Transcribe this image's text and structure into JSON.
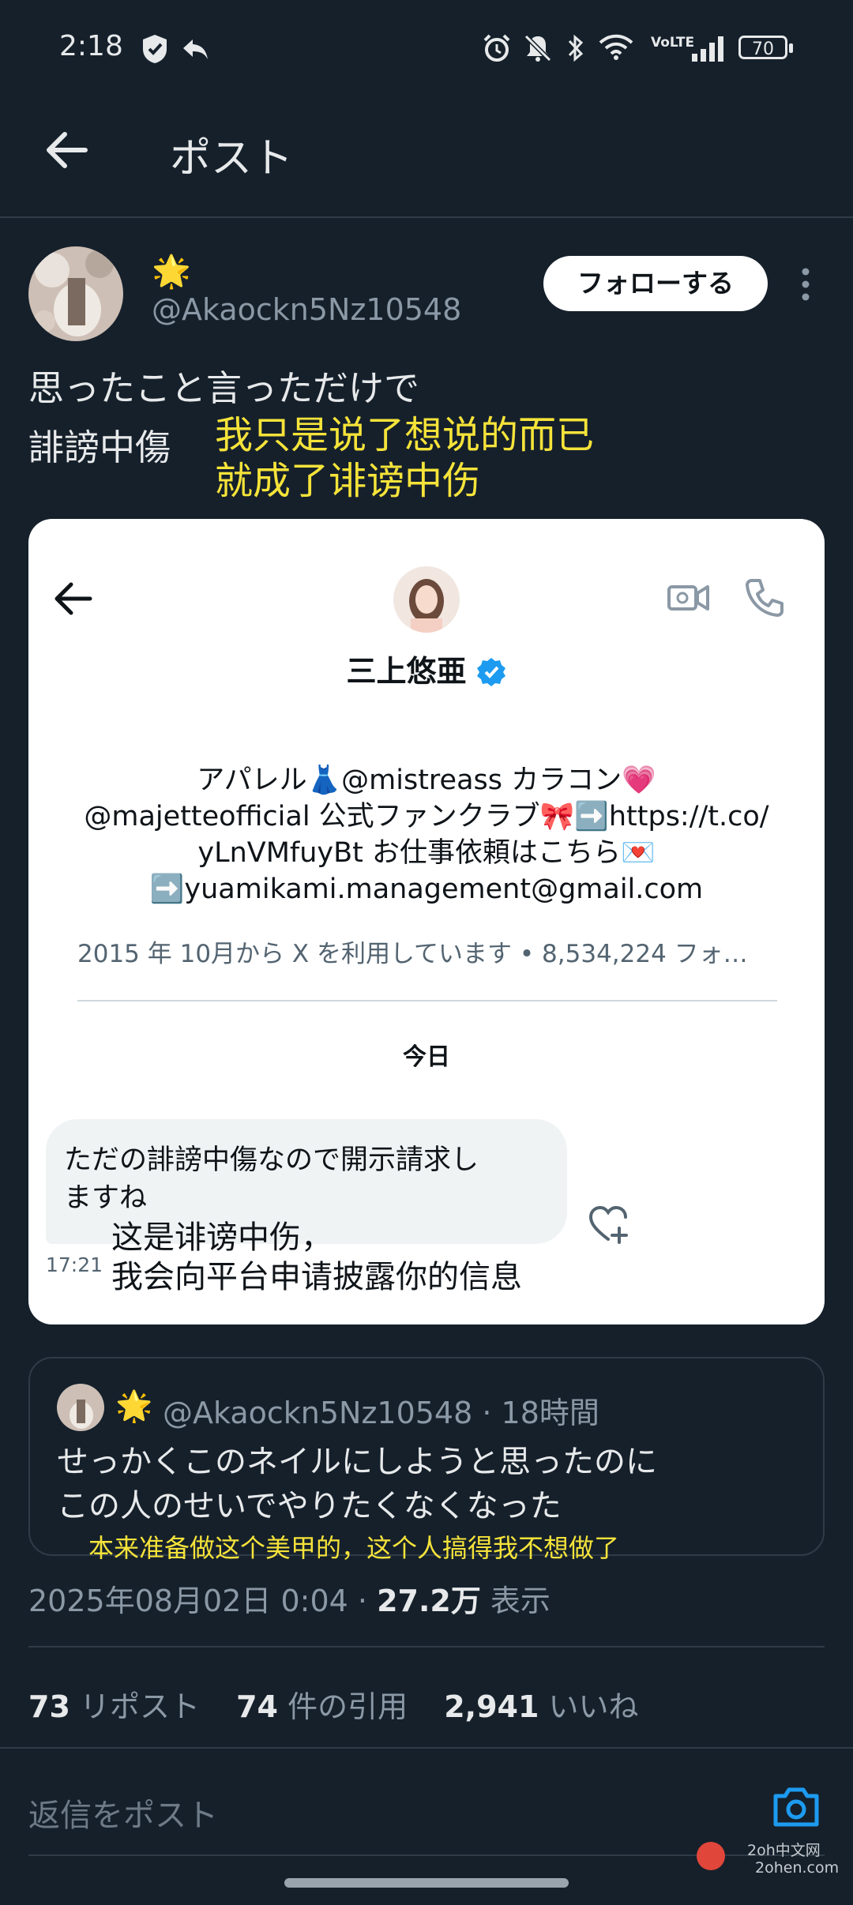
{
  "status_bar": {
    "time": "2:18",
    "battery": "70",
    "network": "VoLTE"
  },
  "header": {
    "title": "ポスト"
  },
  "post": {
    "handle": "@Akaockn5Nz10548",
    "badge_emoji": "🌟",
    "follow_label": "フォローする",
    "text_line1": "思ったこと言っただけで",
    "text_line2": "誹謗中傷",
    "overlay_line1": "我只是说了想说的而已",
    "overlay_line2": "就成了诽谤中伤"
  },
  "embedded_screenshot": {
    "profile_name": "三上悠亜",
    "bio_line1": "アパレル👗@mistreass カラコン💗",
    "bio_line2": "@majetteofficial 公式ファンクラブ🎀➡️https://t.co/",
    "bio_line3": "yLnVMfuyBt お仕事依頼はこちら💌",
    "bio_line4": "➡️yuamikami.management@gmail.com",
    "meta": "2015 年 10月から X を利用しています • 8,534,224 フォ…",
    "day_label": "今日",
    "message_line1": "ただの誹謗中傷なので開示請求し",
    "message_line2": "ますね",
    "message_time": "17:21",
    "overlay_line1": "这是诽谤中伤，",
    "overlay_line2": "我会向平台申请披露你的信息"
  },
  "quoted_post": {
    "badge_emoji": "🌟",
    "handle": "@Akaockn5Nz10548",
    "time_ago": "· 18時間",
    "text_line1": "せっかくこのネイルにしようと思ったのに",
    "text_line2": "この人のせいでやりたくなくなった",
    "overlay": "本来准备做这个美甲的，这个人搞得我不想做了"
  },
  "meta_line": {
    "date": "2025年08月02日 0:04 · ",
    "views_count": "27.2万",
    "views_label": " 表示"
  },
  "stats": {
    "reposts_count": "73",
    "reposts_label": "リポスト",
    "quotes_count": "74",
    "quotes_label": "件の引用",
    "likes_count": "2,941",
    "likes_label": "いいね"
  },
  "reply": {
    "placeholder": "返信をポスト"
  },
  "watermark": {
    "line1": "2oh中文网",
    "line2": "2ohen.com"
  }
}
